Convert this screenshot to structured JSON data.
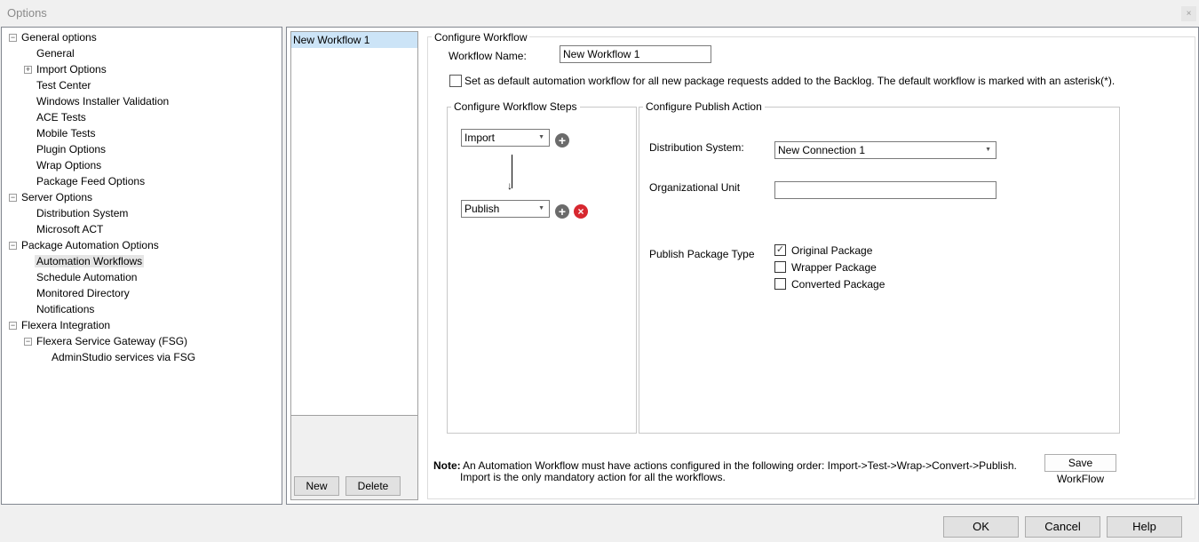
{
  "window": {
    "title": "Options",
    "close": "×"
  },
  "tree": {
    "items": [
      {
        "label": "General options",
        "expander": "−"
      },
      {
        "label": "General"
      },
      {
        "label": "Import Options",
        "expander": "+"
      },
      {
        "label": "Test Center"
      },
      {
        "label": "Windows Installer Validation"
      },
      {
        "label": "ACE Tests"
      },
      {
        "label": "Mobile Tests"
      },
      {
        "label": "Plugin Options"
      },
      {
        "label": "Wrap Options"
      },
      {
        "label": "Package Feed Options"
      },
      {
        "label": "Server Options",
        "expander": "−"
      },
      {
        "label": "Distribution System"
      },
      {
        "label": "Microsoft ACT"
      },
      {
        "label": "Package Automation Options",
        "expander": "−"
      },
      {
        "label": "Automation Workflows"
      },
      {
        "label": "Schedule Automation"
      },
      {
        "label": "Monitored Directory"
      },
      {
        "label": "Notifications"
      },
      {
        "label": "Flexera Integration",
        "expander": "−"
      },
      {
        "label": "Flexera Service Gateway (FSG)",
        "expander": "−"
      },
      {
        "label": "AdminStudio services via FSG"
      }
    ]
  },
  "workflows": {
    "items": [
      "New Workflow 1"
    ],
    "new_label": "New",
    "delete_label": "Delete"
  },
  "configure": {
    "legend": "Configure Workflow",
    "name_label": "Workflow Name:",
    "name_value": "New Workflow 1",
    "default_label": "Set as default automation workflow for all new package requests added to the Backlog. The default workflow is marked with an asterisk(*)."
  },
  "steps": {
    "legend": "Configure Workflow Steps",
    "step1": "Import",
    "step2": "Publish",
    "arrow": "↓",
    "add": "+",
    "remove": "×"
  },
  "publish": {
    "legend": "Configure Publish Action",
    "dist_label": "Distribution System:",
    "dist_value": "New Connection 1",
    "ou_label": "Organizational Unit",
    "ou_value": "",
    "type_label": "Publish Package Type",
    "options": [
      {
        "label": "Original Package",
        "checked": true
      },
      {
        "label": "Wrapper Package",
        "checked": false
      },
      {
        "label": "Converted Package",
        "checked": false
      }
    ],
    "check_mark": "✓"
  },
  "note": {
    "prefix": "Note:",
    "line1": "An Automation Workflow must have actions configured in the following order: Import->Test->Wrap->Convert->Publish.",
    "line2": "Import is the only mandatory action for all the workflows.",
    "save_label": "Save WorkFlow"
  },
  "footer": {
    "ok": "OK",
    "cancel": "Cancel",
    "help": "Help"
  }
}
